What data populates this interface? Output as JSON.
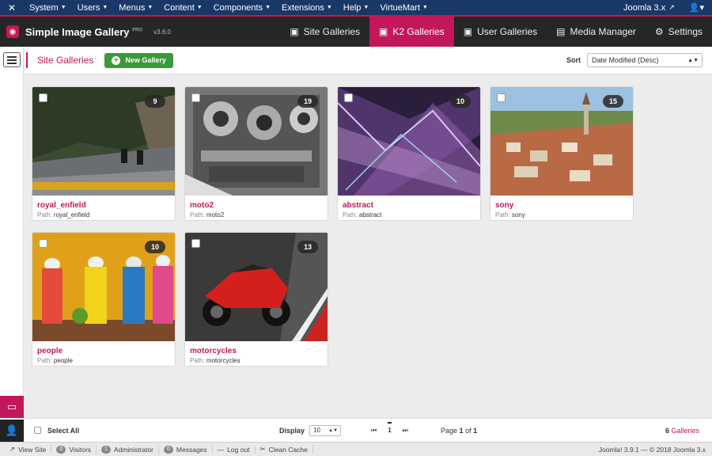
{
  "topnav": {
    "logo_icon": "joomla-icon",
    "menus": [
      "System",
      "Users",
      "Menus",
      "Content",
      "Components",
      "Extensions",
      "Help"
    ],
    "virtuemart": "VirtueMart",
    "site_link": "Joomla 3.x"
  },
  "app": {
    "name": "Simple Image Gallery",
    "pro": "PRO",
    "version": "v3.6.0",
    "tabs": [
      {
        "label": "Site Galleries",
        "icon": "image-icon"
      },
      {
        "label": "K2 Galleries",
        "icon": "image-icon"
      },
      {
        "label": "User Galleries",
        "icon": "image-icon"
      },
      {
        "label": "Media Manager",
        "icon": "media-icon"
      },
      {
        "label": "Settings",
        "icon": "gear-icon"
      }
    ],
    "active_tab": "K2 Galleries"
  },
  "toolbar": {
    "title": "Site Galleries",
    "new_gallery": "New Gallery",
    "sort_label": "Sort",
    "sort_value": "Date Modified (Desc)"
  },
  "galleries": [
    {
      "name": "royal_enfield",
      "path_label": "Path:",
      "path": "royal_enfield",
      "count": "9"
    },
    {
      "name": "moto2",
      "path_label": "Path:",
      "path": "moto2",
      "count": "19"
    },
    {
      "name": "abstract",
      "path_label": "Path:",
      "path": "abstract",
      "count": "10"
    },
    {
      "name": "sony",
      "path_label": "Path:",
      "path": "sony",
      "count": "15"
    },
    {
      "name": "people",
      "path_label": "Path:",
      "path": "people",
      "count": "10"
    },
    {
      "name": "motorcycles",
      "path_label": "Path:",
      "path": "motorcycles",
      "count": "13"
    }
  ],
  "bottom": {
    "select_all": "Select All",
    "display_label": "Display",
    "display_value": "10",
    "page_first": "⏮",
    "page_current": "1",
    "page_last": "⏭",
    "page_info_prefix": "Page",
    "page_info_current": "1",
    "page_info_of": "of",
    "page_info_total": "1",
    "gallery_count": "6",
    "gallery_label": "Galleries"
  },
  "status": {
    "view_site": "View Site",
    "visitors_count": "0",
    "visitors": "Visitors",
    "admin_count": "1",
    "admin": "Administrator",
    "messages_count": "0",
    "messages": "Messages",
    "logout": "Log out",
    "clean_cache": "Clean Cache",
    "footer": "Joomla! 3.9.1  —  © 2018 Joomla 3.x"
  },
  "colors": {
    "accent": "#c2185b",
    "nav": "#1a3867",
    "new_button": "#3a9a3a"
  }
}
